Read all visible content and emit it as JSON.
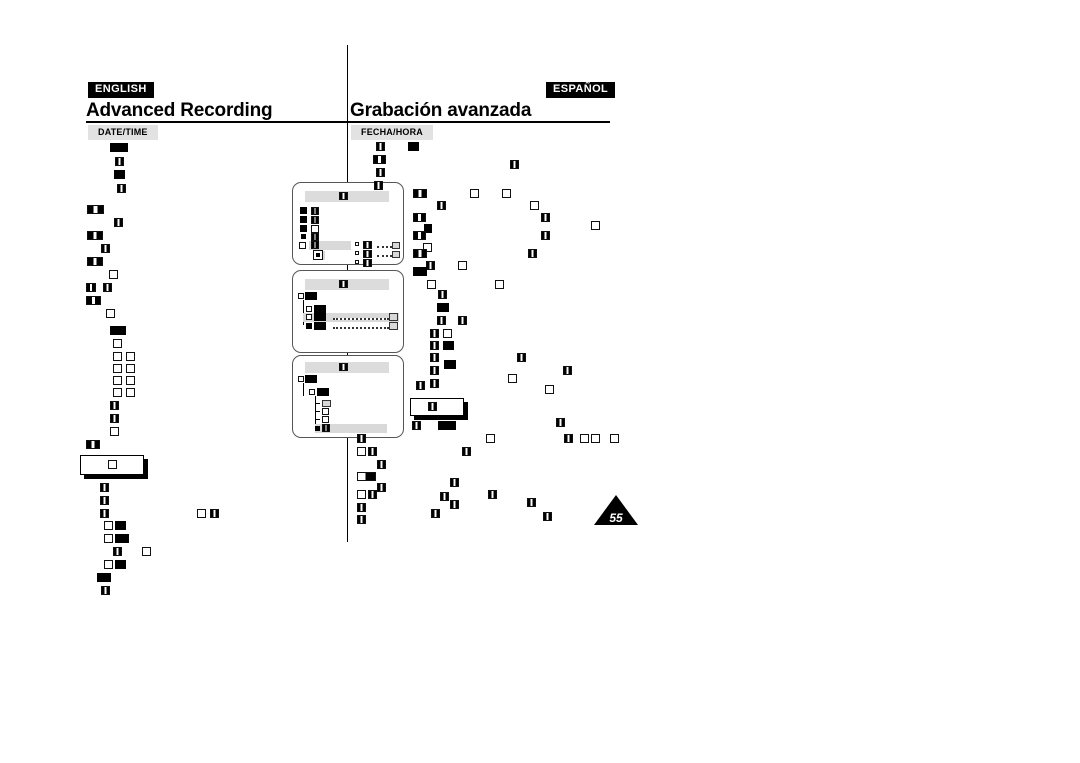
{
  "document": {
    "type": "camcorder-user-manual-page",
    "layout": "two-column-bilingual",
    "page_number": "55"
  },
  "left_column": {
    "language_badge": "ENGLISH",
    "section_title": "Advanced Recording",
    "subsection_tag": "DATE/TIME"
  },
  "right_column": {
    "language_badge": "ESPAÑOL",
    "section_title": "Grabación avanzada",
    "subsection_tag": "FECHA/HORA"
  },
  "figures": {
    "lcd_panels": [
      {
        "name": "menu-screen-1"
      },
      {
        "name": "menu-screen-2"
      },
      {
        "name": "menu-screen-3"
      }
    ]
  },
  "colors": {
    "text": "#000000",
    "badge_background": "#000000",
    "badge_text": "#ffffff",
    "tag_background": "#e2e2e2",
    "lcd_title_background": "#dcdcdc",
    "lcd_highlight": "#d9d9d9",
    "page_background": "#ffffff"
  }
}
